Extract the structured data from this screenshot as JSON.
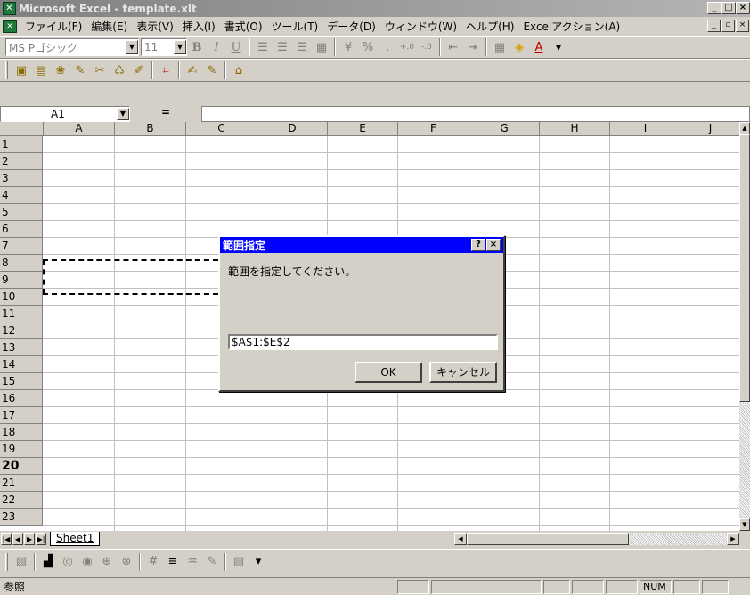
{
  "window": {
    "title": "Microsoft Excel - template.xlt",
    "app_icon": "excel-icon",
    "controls": [
      "_",
      "□",
      "×"
    ]
  },
  "menubar": {
    "items": [
      "ファイル(F)",
      "編集(E)",
      "表示(V)",
      "挿入(I)",
      "書式(O)",
      "ツール(T)",
      "データ(D)",
      "ウィンドウ(W)",
      "ヘルプ(H)",
      "Excelアクション(A)"
    ],
    "doc_controls": [
      "_",
      "▫",
      "×"
    ]
  },
  "format_toolbar": {
    "font_name": "MS Pゴシック",
    "font_size": "11",
    "buttons": [
      "B",
      "I",
      "U"
    ]
  },
  "formula_bar": {
    "name_box": "A1",
    "equals": "="
  },
  "sheet": {
    "columns": [
      "A",
      "B",
      "C",
      "D",
      "E",
      "F",
      "G",
      "H",
      "I",
      "J"
    ],
    "rows": [
      "1",
      "2",
      "3",
      "4",
      "5",
      "6",
      "7",
      "8",
      "9",
      "10",
      "11",
      "12",
      "13",
      "14",
      "15",
      "16",
      "17",
      "18",
      "19",
      "20",
      "21",
      "22",
      "23"
    ],
    "bold_row": "20",
    "tab": "Sheet1"
  },
  "dialog": {
    "title": "範囲指定",
    "help": "?",
    "close": "×",
    "message": "範囲を指定してください。",
    "range_value": "$A$1:$E$2",
    "ok_label": "OK",
    "cancel_label": "キャンセル"
  },
  "statusbar": {
    "mode": "参照",
    "num": "NUM"
  }
}
